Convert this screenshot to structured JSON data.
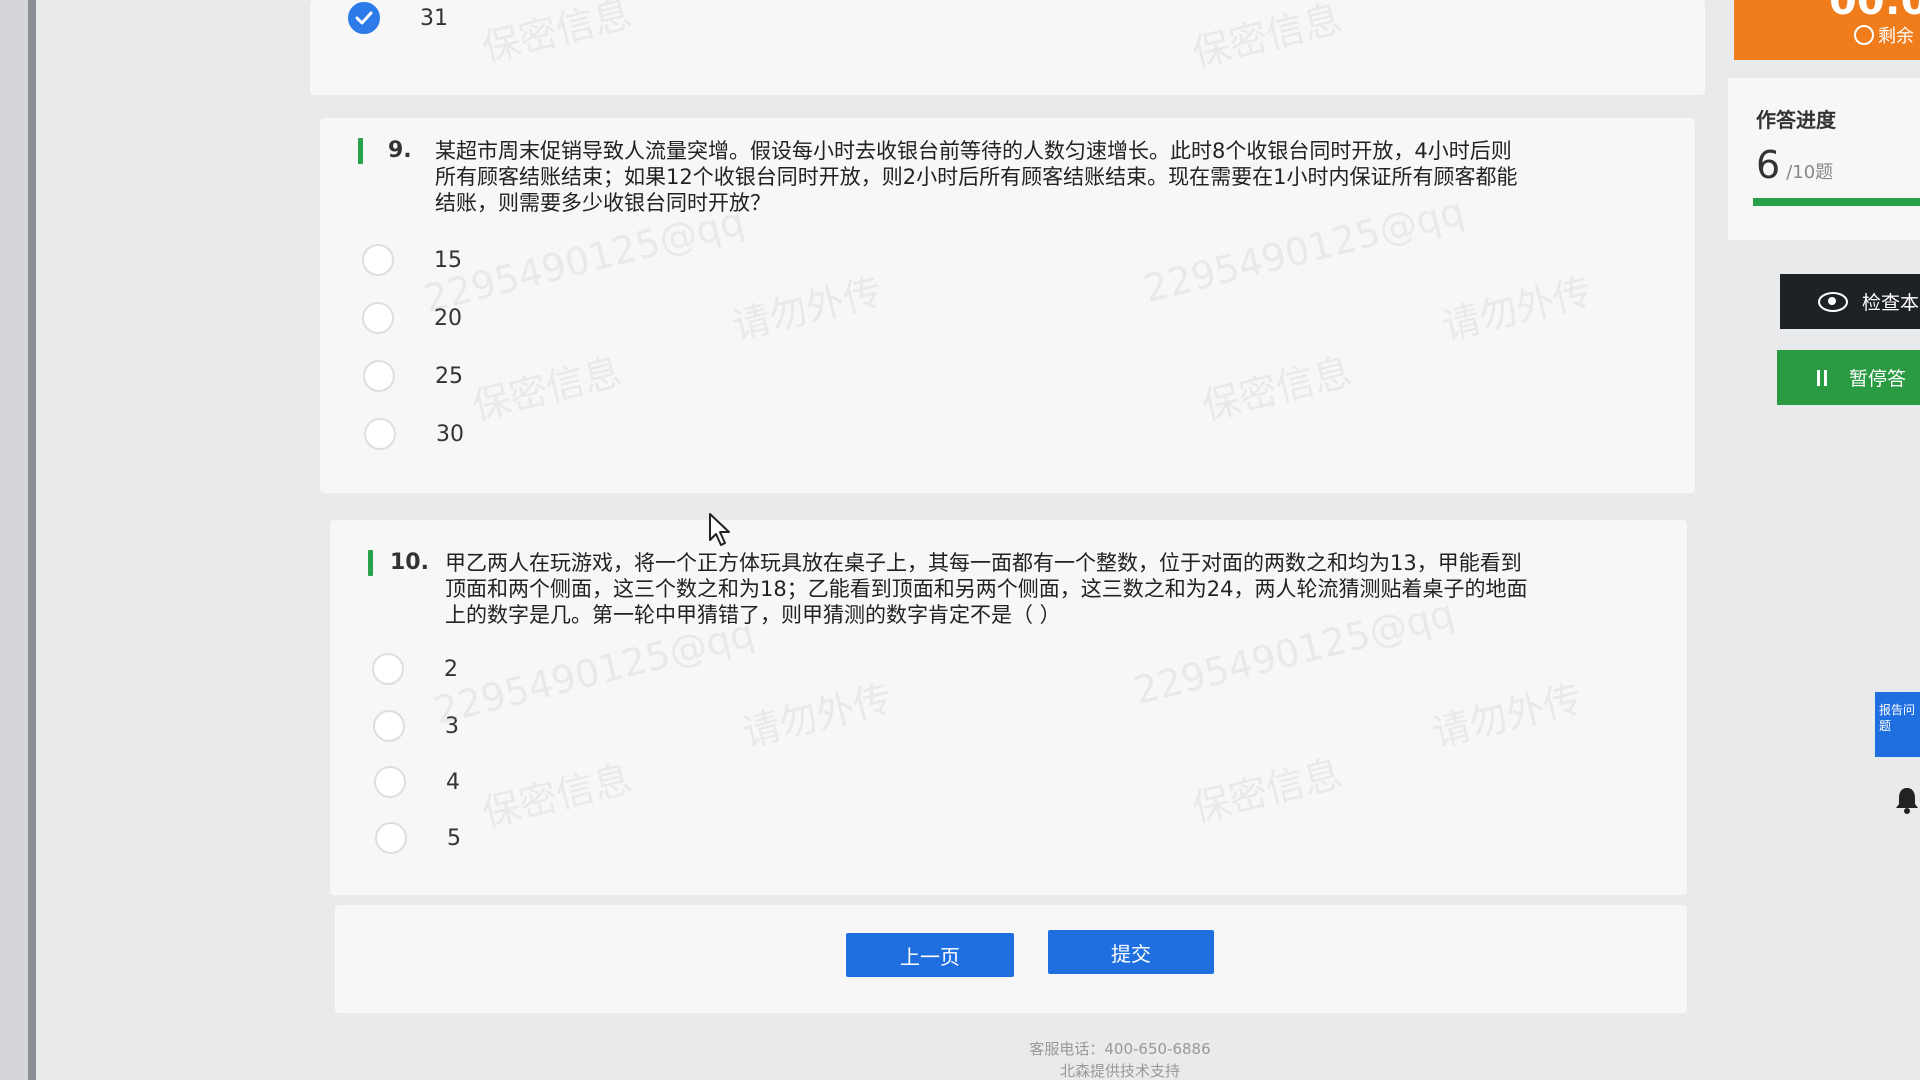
{
  "top": {
    "selected_value": "31"
  },
  "q9": {
    "number": "9.",
    "lines": [
      "某超市周末促销导致人流量突增。假设每小时去收银台前等待的人数匀速增长。此时8个收银台同时开放，4小时后则",
      "所有顾客结账结束；如果12个收银台同时开放，则2小时后所有顾客结账结束。现在需要在1小时内保证所有顾客都能",
      "结账，则需要多少收银台同时开放？"
    ],
    "options": [
      "15",
      "20",
      "25",
      "30"
    ]
  },
  "q10": {
    "number": "10.",
    "lines": [
      "甲乙两人在玩游戏，将一个正方体玩具放在桌子上，其每一面都有一个整数，位于对面的两数之和均为13，甲能看到",
      "顶面和两个侧面，这三个数之和为18；乙能看到顶面和另两个侧面，这三数之和为24，两人轮流猜测贴着桌子的地面",
      "上的数字是几。第一轮中甲猜错了，则甲猜测的数字肯定不是（ ）"
    ],
    "options": [
      "2",
      "3",
      "4",
      "5"
    ]
  },
  "nav": {
    "prev_label": "上一页",
    "submit_label": "提交"
  },
  "footer": {
    "phone": "客服电话：400-650-6886",
    "support": "北森提供技术支持"
  },
  "watermark": {
    "id": "2295490125@qq",
    "line1": "请勿外传",
    "line2": "保密信息"
  },
  "sidebar": {
    "timer": "00:0",
    "timer_sub": "剩余",
    "progress_title": "作答进度",
    "progress_current": "6",
    "progress_total": "/10题",
    "progress_fraction": 0.6,
    "check_label": "检查本",
    "pause_label": "暂停答",
    "report_label": "报告问题"
  },
  "colors": {
    "accent_blue": "#1f6fe0",
    "accent_green": "#27a24a",
    "timer_orange": "#f07c1c",
    "check_button": "#1e2226"
  }
}
